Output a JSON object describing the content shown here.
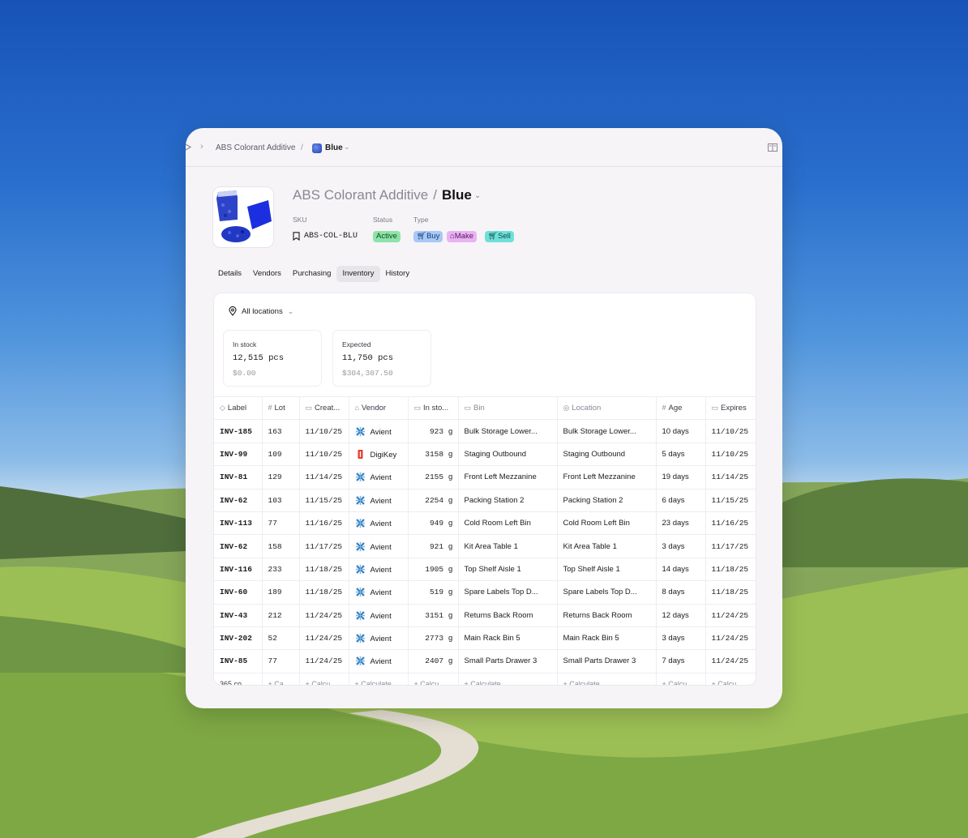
{
  "breadcrumb": {
    "parent": "ABS Colorant Additive",
    "separator": "/",
    "current": "Blue"
  },
  "header": {
    "parent_title": "ABS Colorant Additive",
    "separator": "/",
    "title": "Blue",
    "sku_label": "SKU",
    "sku_value": "ABS-COL-BLU",
    "status_label": "Status",
    "status_value": "Active",
    "type_label": "Type",
    "types": [
      "Buy",
      "Make",
      "Sell"
    ]
  },
  "tabs": [
    "Details",
    "Vendors",
    "Purchasing",
    "Inventory",
    "History"
  ],
  "active_tab": "Inventory",
  "location_filter": "All locations",
  "stats": {
    "in_stock": {
      "label": "In stock",
      "value": "12,515 pcs",
      "sub": "$0.00"
    },
    "expected": {
      "label": "Expected",
      "value": "11,750 pcs",
      "sub": "$304,307.50"
    }
  },
  "table": {
    "columns": [
      "Label",
      "Lot",
      "Creat...",
      "Vendor",
      "In sto...",
      "Bin",
      "Location",
      "Age",
      "Expires"
    ],
    "rows": [
      [
        "INV-185",
        "163",
        "11/10/25",
        "Avient",
        "923 g",
        "Bulk Storage Lower...",
        "Bulk Storage Lower...",
        "10 days",
        "11/10/25"
      ],
      [
        "INV-99",
        "109",
        "11/10/25",
        "DigiKey",
        "3158 g",
        "Staging Outbound",
        "Staging Outbound",
        "5 days",
        "11/10/25"
      ],
      [
        "INV-81",
        "129",
        "11/14/25",
        "Avient",
        "2155 g",
        "Front Left Mezzanine",
        "Front Left Mezzanine",
        "19 days",
        "11/14/25"
      ],
      [
        "INV-62",
        "103",
        "11/15/25",
        "Avient",
        "2254 g",
        "Packing Station 2",
        "Packing Station 2",
        "6 days",
        "11/15/25"
      ],
      [
        "INV-113",
        "77",
        "11/16/25",
        "Avient",
        "949 g",
        "Cold Room Left Bin",
        "Cold Room Left Bin",
        "23 days",
        "11/16/25"
      ],
      [
        "INV-62",
        "158",
        "11/17/25",
        "Avient",
        "921 g",
        "Kit Area Table 1",
        "Kit Area Table 1",
        "3 days",
        "11/17/25"
      ],
      [
        "INV-116",
        "233",
        "11/18/25",
        "Avient",
        "1905 g",
        "Top Shelf Aisle 1",
        "Top Shelf Aisle 1",
        "14 days",
        "11/18/25"
      ],
      [
        "INV-60",
        "189",
        "11/18/25",
        "Avient",
        "519 g",
        "Spare Labels Top D...",
        "Spare Labels Top D...",
        "8 days",
        "11/18/25"
      ],
      [
        "INV-43",
        "212",
        "11/24/25",
        "Avient",
        "3151 g",
        "Returns Back Room",
        "Returns Back Room",
        "12 days",
        "11/24/25"
      ],
      [
        "INV-202",
        "52",
        "11/24/25",
        "Avient",
        "2773 g",
        "Main Rack Bin 5",
        "Main Rack Bin 5",
        "3 days",
        "11/24/25"
      ],
      [
        "INV-85",
        "77",
        "11/24/25",
        "Avient",
        "2407 g",
        "Small Parts Drawer 3",
        "Small Parts Drawer 3",
        "7 days",
        "11/24/25"
      ]
    ],
    "footer": [
      "365 co...",
      "+ Ca...",
      "+ Calcu...",
      "+ Calculate",
      "+ Calcu...",
      "+ Calculate",
      "+ Calculate",
      "+ Calcu...",
      "+ Calcu..."
    ]
  },
  "colors": {
    "active": "#8ee3a8",
    "buy": "#a9c8f5",
    "make": "#e9b3f2",
    "sell": "#6fe0d9"
  }
}
